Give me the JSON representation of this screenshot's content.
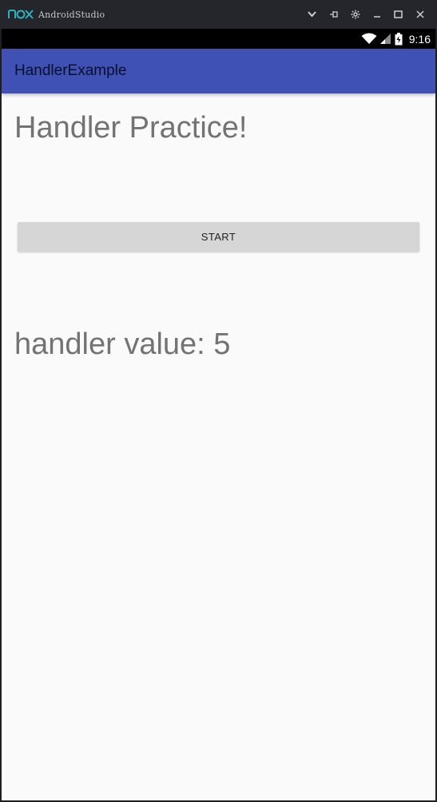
{
  "window": {
    "title": "AndroidStudio",
    "logo_text": "nox",
    "controls": [
      "chevron-down-icon",
      "pin-icon",
      "gear-icon",
      "minimize-icon",
      "maximize-icon",
      "close-icon"
    ]
  },
  "statusbar": {
    "time": "9:16",
    "icons": [
      "wifi-icon",
      "signal-icon",
      "battery-charging-icon"
    ]
  },
  "appbar": {
    "title": "HandlerExample",
    "color": "#3f51b5"
  },
  "main": {
    "heading": "Handler Practice!",
    "start_button_label": "START",
    "value_label": "handler value: 5"
  },
  "colors": {
    "accent": "#3f51b5",
    "background": "#fafafa",
    "text_secondary": "#737373"
  }
}
